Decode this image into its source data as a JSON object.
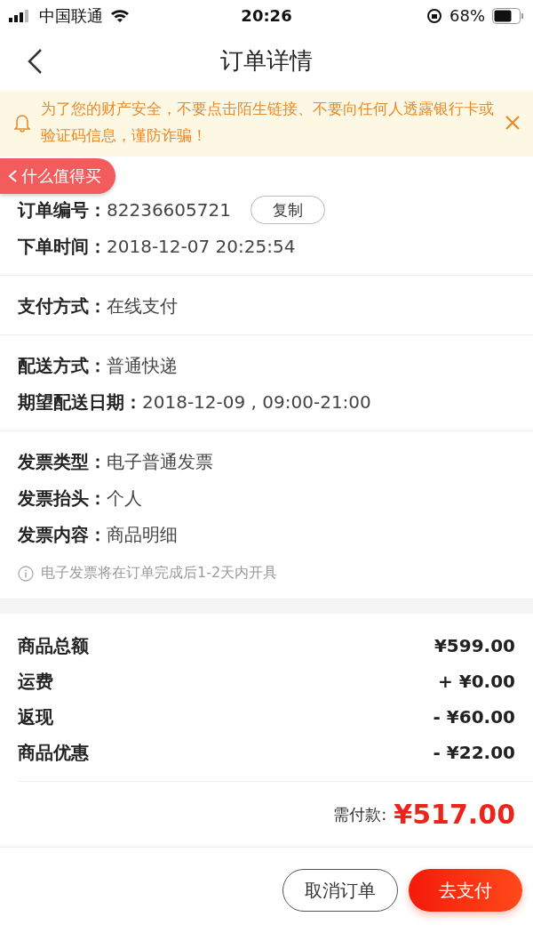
{
  "status_bar": {
    "carrier": "中国联通",
    "time": "20:26",
    "battery_text": "68%"
  },
  "nav": {
    "title": "订单详情"
  },
  "notice": {
    "text": "为了您的财产安全，不要点击陌生链接、不要向任何人透露银行卡或验证码信息，谨防诈骗！"
  },
  "float_badge": {
    "label": "什么值得买"
  },
  "sections": [
    {
      "rows": [
        {
          "label": "订单编号：",
          "value": "82236605721",
          "action": "复制"
        },
        {
          "label": "下单时间：",
          "value": "2018-12-07 20:25:54"
        }
      ]
    },
    {
      "rows": [
        {
          "label": "支付方式：",
          "value": "在线支付"
        }
      ]
    },
    {
      "rows": [
        {
          "label": "配送方式：",
          "value": "普通快递"
        },
        {
          "label": "期望配送日期：",
          "value": "2018-12-09 , 09:00-21:00"
        }
      ]
    },
    {
      "rows": [
        {
          "label": "发票类型：",
          "value": "电子普通发票"
        },
        {
          "label": "发票抬头：",
          "value": "个人"
        },
        {
          "label": "发票内容：",
          "value": "商品明细"
        }
      ],
      "note": "电子发票将在订单完成后1-2天内开具"
    }
  ],
  "totals": [
    {
      "label": "商品总额",
      "amount": "¥599.00"
    },
    {
      "label": "运费",
      "amount": "+ ¥0.00"
    },
    {
      "label": "返现",
      "amount": "- ¥60.00"
    },
    {
      "label": "商品优惠",
      "amount": "- ¥22.00"
    }
  ],
  "payable": {
    "label": "需付款:",
    "amount": "¥517.00"
  },
  "buttons": [
    {
      "label": "取消订单",
      "kind": "outline"
    },
    {
      "label": "去支付",
      "kind": "primary"
    }
  ]
}
